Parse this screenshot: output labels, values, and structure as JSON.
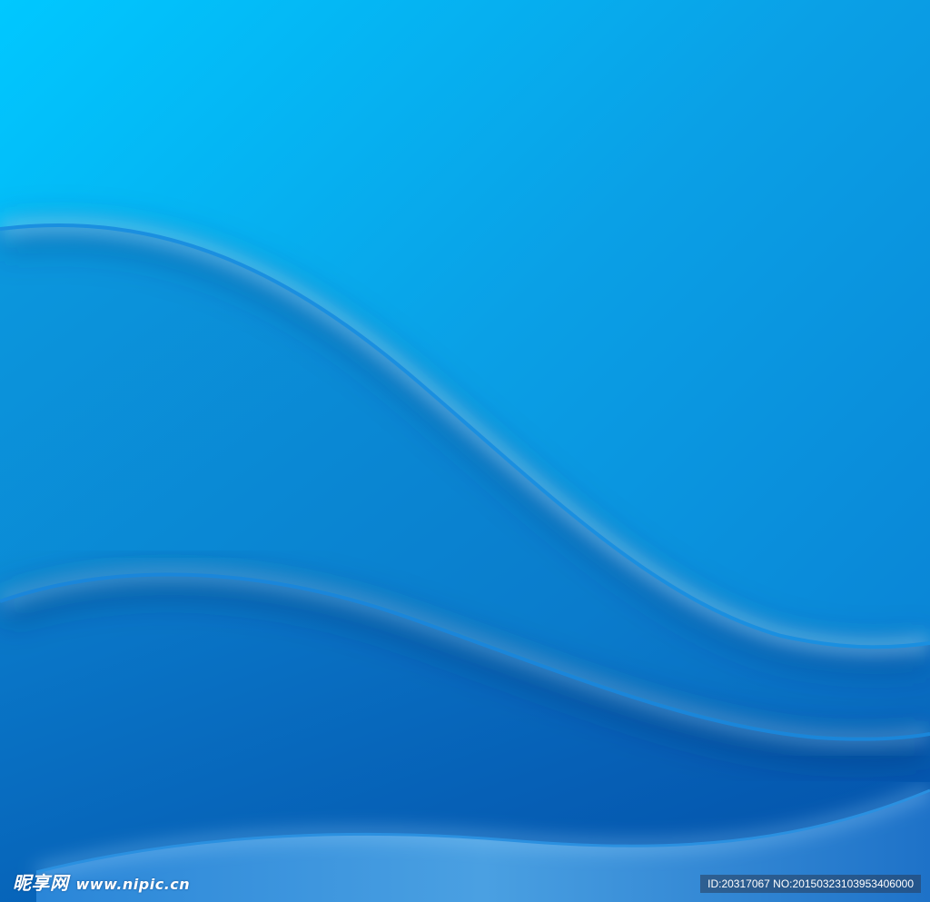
{
  "image": {
    "colors": {
      "top_left": "#00c8ff",
      "top_right": "#0a8ee0",
      "mid": "#0a7fd0",
      "deep": "#0350a8",
      "highlight": "#a8e4ff"
    },
    "waves": [
      "wave-upper",
      "wave-middle",
      "wave-lower"
    ]
  },
  "watermark": {
    "brand": "昵享网",
    "url": "www.nipic.cn",
    "id_text": "ID:20317067 NO:20150323103953406000"
  }
}
